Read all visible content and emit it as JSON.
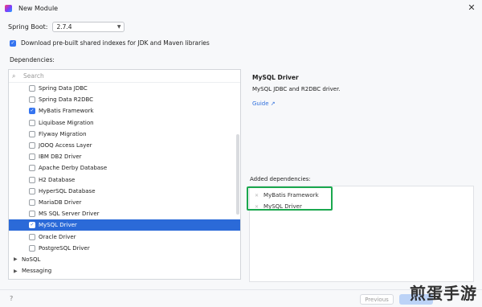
{
  "window": {
    "title": "New Module"
  },
  "spring_boot": {
    "label": "Spring Boot:",
    "version": "2.7.4"
  },
  "download_option": {
    "label": "Download pre-built shared indexes for JDK and Maven libraries",
    "checked": true
  },
  "dependencies": {
    "label": "Dependencies:",
    "search_placeholder": "Search",
    "items": [
      {
        "label": "Spring Data JDBC",
        "checked": false,
        "selected": false
      },
      {
        "label": "Spring Data R2DBC",
        "checked": false,
        "selected": false
      },
      {
        "label": "MyBatis Framework",
        "checked": true,
        "selected": false
      },
      {
        "label": "Liquibase Migration",
        "checked": false,
        "selected": false
      },
      {
        "label": "Flyway Migration",
        "checked": false,
        "selected": false
      },
      {
        "label": "JOOQ Access Layer",
        "checked": false,
        "selected": false
      },
      {
        "label": "IBM DB2 Driver",
        "checked": false,
        "selected": false
      },
      {
        "label": "Apache Derby Database",
        "checked": false,
        "selected": false
      },
      {
        "label": "H2 Database",
        "checked": false,
        "selected": false
      },
      {
        "label": "HyperSQL Database",
        "checked": false,
        "selected": false
      },
      {
        "label": "MariaDB Driver",
        "checked": false,
        "selected": false
      },
      {
        "label": "MS SQL Server Driver",
        "checked": false,
        "selected": false
      },
      {
        "label": "MySQL Driver",
        "checked": true,
        "selected": true
      },
      {
        "label": "Oracle Driver",
        "checked": false,
        "selected": false
      },
      {
        "label": "PostgreSQL Driver",
        "checked": false,
        "selected": false
      }
    ],
    "groups": [
      {
        "label": "NoSQL"
      },
      {
        "label": "Messaging"
      }
    ]
  },
  "detail": {
    "title": "MySQL Driver",
    "description": "MySQL JDBC and R2DBC driver.",
    "guide_label": "Guide ↗"
  },
  "added": {
    "label": "Added dependencies:",
    "items": [
      {
        "label": "MyBatis Framework"
      },
      {
        "label": "MySQL Driver"
      }
    ],
    "highlight_color": "#1aa84e"
  },
  "footer": {
    "help": "?",
    "previous_label": "Previous"
  },
  "watermark": "煎蛋手游",
  "colors": {
    "accent": "#3574f0",
    "selection": "#2b6ad8",
    "link": "#2f6fdc"
  }
}
